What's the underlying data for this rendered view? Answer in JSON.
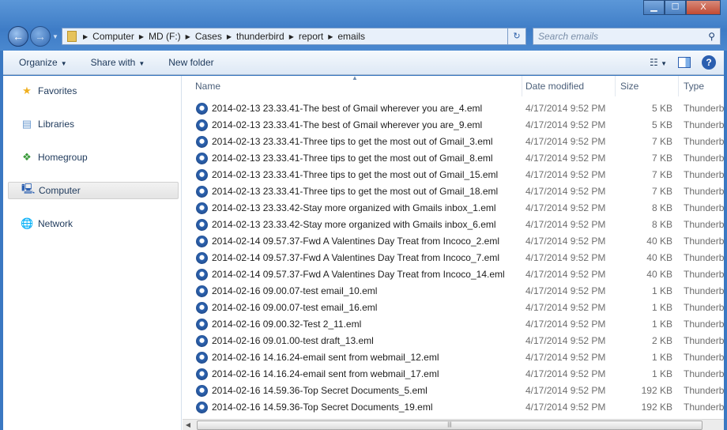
{
  "window": {
    "minimize": "▁",
    "maximize": "☐",
    "close": "X"
  },
  "address": {
    "crumbs": [
      "Computer",
      "MD (F:)",
      "Cases",
      "thunderbird",
      "report",
      "emails"
    ]
  },
  "search": {
    "placeholder": "Search emails"
  },
  "toolbar": {
    "organize": "Organize",
    "share_with": "Share with",
    "new_folder": "New folder"
  },
  "sidebar": {
    "items": [
      {
        "label": "Favorites",
        "icon": "star-icon"
      },
      {
        "label": "Libraries",
        "icon": "libraries-icon"
      },
      {
        "label": "Homegroup",
        "icon": "homegroup-icon"
      },
      {
        "label": "Computer",
        "icon": "computer-icon",
        "selected": true
      },
      {
        "label": "Network",
        "icon": "network-icon"
      }
    ]
  },
  "columns": {
    "name": "Name",
    "date": "Date modified",
    "size": "Size",
    "type": "Type"
  },
  "files": [
    {
      "name": "2014-02-13 23.33.41-The best of Gmail wherever you are_4.eml",
      "date": "4/17/2014 9:52 PM",
      "size": "5 KB",
      "type": "Thunderbird"
    },
    {
      "name": "2014-02-13 23.33.41-The best of Gmail wherever you are_9.eml",
      "date": "4/17/2014 9:52 PM",
      "size": "5 KB",
      "type": "Thunderbird"
    },
    {
      "name": "2014-02-13 23.33.41-Three tips to get the most out of Gmail_3.eml",
      "date": "4/17/2014 9:52 PM",
      "size": "7 KB",
      "type": "Thunderbird"
    },
    {
      "name": "2014-02-13 23.33.41-Three tips to get the most out of Gmail_8.eml",
      "date": "4/17/2014 9:52 PM",
      "size": "7 KB",
      "type": "Thunderbird"
    },
    {
      "name": "2014-02-13 23.33.41-Three tips to get the most out of Gmail_15.eml",
      "date": "4/17/2014 9:52 PM",
      "size": "7 KB",
      "type": "Thunderbird"
    },
    {
      "name": "2014-02-13 23.33.41-Three tips to get the most out of Gmail_18.eml",
      "date": "4/17/2014 9:52 PM",
      "size": "7 KB",
      "type": "Thunderbird"
    },
    {
      "name": "2014-02-13 23.33.42-Stay more organized with Gmails inbox_1.eml",
      "date": "4/17/2014 9:52 PM",
      "size": "8 KB",
      "type": "Thunderbird"
    },
    {
      "name": "2014-02-13 23.33.42-Stay more organized with Gmails inbox_6.eml",
      "date": "4/17/2014 9:52 PM",
      "size": "8 KB",
      "type": "Thunderbird"
    },
    {
      "name": "2014-02-14 09.57.37-Fwd A Valentines Day Treat from Incoco_2.eml",
      "date": "4/17/2014 9:52 PM",
      "size": "40 KB",
      "type": "Thunderbird"
    },
    {
      "name": "2014-02-14 09.57.37-Fwd A Valentines Day Treat from Incoco_7.eml",
      "date": "4/17/2014 9:52 PM",
      "size": "40 KB",
      "type": "Thunderbird"
    },
    {
      "name": "2014-02-14 09.57.37-Fwd A Valentines Day Treat from Incoco_14.eml",
      "date": "4/17/2014 9:52 PM",
      "size": "40 KB",
      "type": "Thunderbird"
    },
    {
      "name": "2014-02-16 09.00.07-test email_10.eml",
      "date": "4/17/2014 9:52 PM",
      "size": "1 KB",
      "type": "Thunderbird"
    },
    {
      "name": "2014-02-16 09.00.07-test email_16.eml",
      "date": "4/17/2014 9:52 PM",
      "size": "1 KB",
      "type": "Thunderbird"
    },
    {
      "name": "2014-02-16 09.00.32-Test 2_11.eml",
      "date": "4/17/2014 9:52 PM",
      "size": "1 KB",
      "type": "Thunderbird"
    },
    {
      "name": "2014-02-16 09.01.00-test draft_13.eml",
      "date": "4/17/2014 9:52 PM",
      "size": "2 KB",
      "type": "Thunderbird"
    },
    {
      "name": "2014-02-16 14.16.24-email sent from webmail_12.eml",
      "date": "4/17/2014 9:52 PM",
      "size": "1 KB",
      "type": "Thunderbird"
    },
    {
      "name": "2014-02-16 14.16.24-email sent from webmail_17.eml",
      "date": "4/17/2014 9:52 PM",
      "size": "1 KB",
      "type": "Thunderbird"
    },
    {
      "name": "2014-02-16 14.59.36-Top Secret Documents_5.eml",
      "date": "4/17/2014 9:52 PM",
      "size": "192 KB",
      "type": "Thunderbird"
    },
    {
      "name": "2014-02-16 14.59.36-Top Secret Documents_19.eml",
      "date": "4/17/2014 9:52 PM",
      "size": "192 KB",
      "type": "Thunderbird"
    }
  ]
}
